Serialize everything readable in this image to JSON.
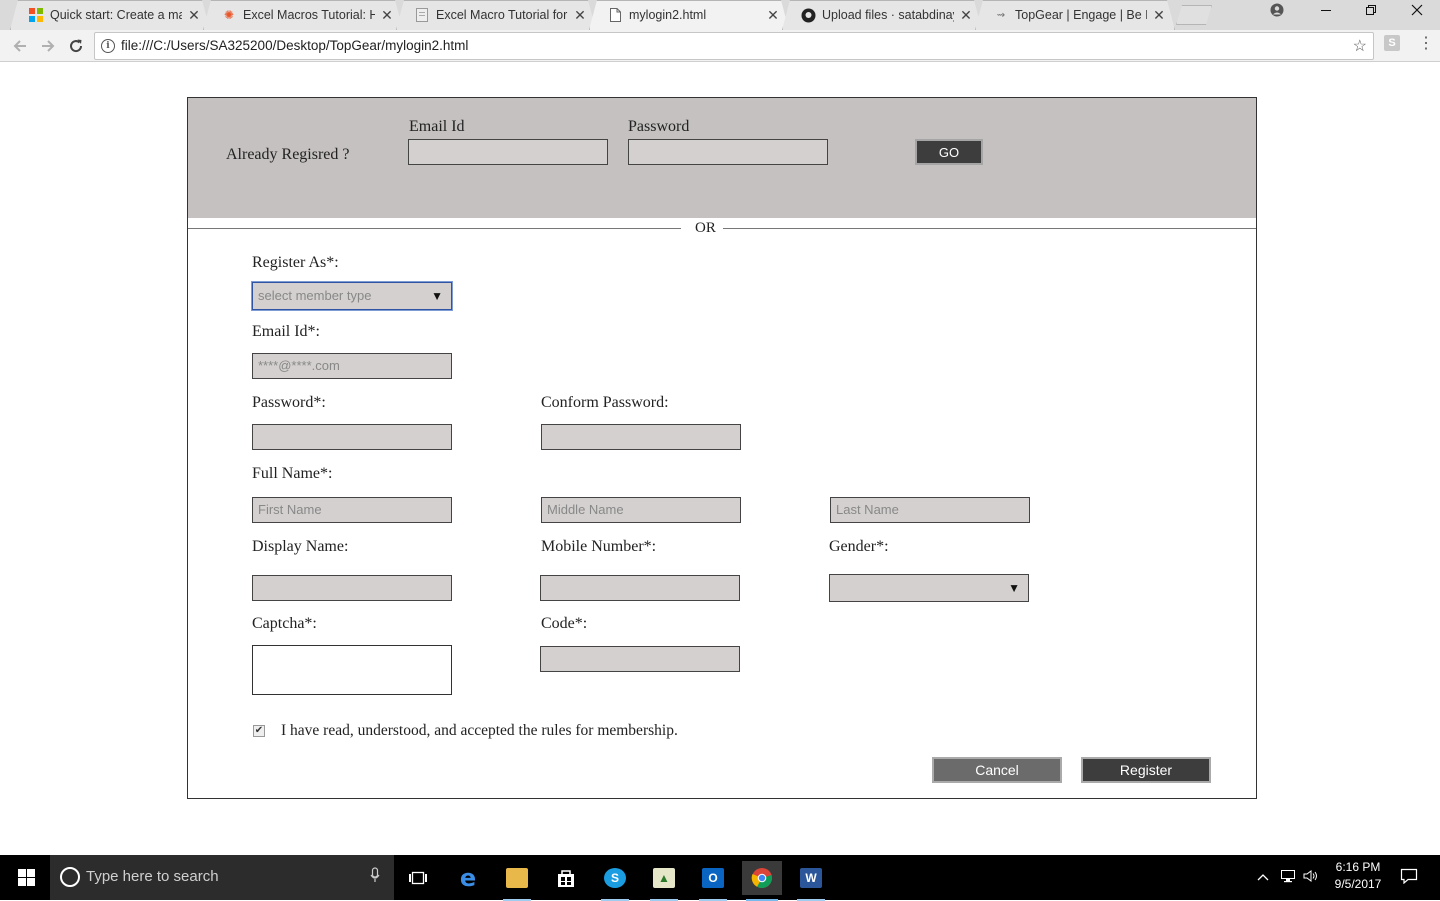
{
  "browser": {
    "tabs": [
      {
        "title": "Quick start: Create a macro",
        "favicon": "ms-grid-icon"
      },
      {
        "title": "Excel Macros Tutorial: How",
        "favicon": "sunburst-icon"
      },
      {
        "title": "Excel Macro Tutorial for Beginners",
        "favicon": "page-icon"
      },
      {
        "title": "mylogin2.html",
        "favicon": "document-icon"
      },
      {
        "title": "Upload files · satabdinaya",
        "favicon": "github-icon"
      },
      {
        "title": "TopGear | Engage | Be Fu",
        "favicon": "topgear-icon"
      }
    ],
    "close_glyph": "✕",
    "url": "file:///C:/Users/SA325200/Desktop/TopGear/mylogin2.html"
  },
  "login": {
    "prompt": "Already Regisred ?",
    "email_label": "Email Id",
    "password_label": "Password",
    "go_label": "GO"
  },
  "divider": {
    "text": "OR"
  },
  "register": {
    "register_as_label": "Register As*:",
    "register_as_value": "select member type",
    "email_label": "Email Id*:",
    "email_placeholder": "****@****.com",
    "password_label": "Password*:",
    "confirm_password_label": "Conform Password:",
    "full_name_label": "Full Name*:",
    "first_name_placeholder": "First Name",
    "middle_name_placeholder": "Middle Name",
    "last_name_placeholder": "Last Name",
    "display_name_label": "Display Name:",
    "mobile_label": "Mobile Number*:",
    "gender_label": "Gender*:",
    "captcha_label": "Captcha*:",
    "code_label": "Code*:",
    "terms_text": "I have read, understood, and accepted the rules for membership.",
    "terms_checked": true,
    "cancel_label": "Cancel",
    "register_label": "Register"
  },
  "taskbar": {
    "search_placeholder": "Type here to search",
    "time": "6:16 PM",
    "date": "9/5/2017"
  }
}
